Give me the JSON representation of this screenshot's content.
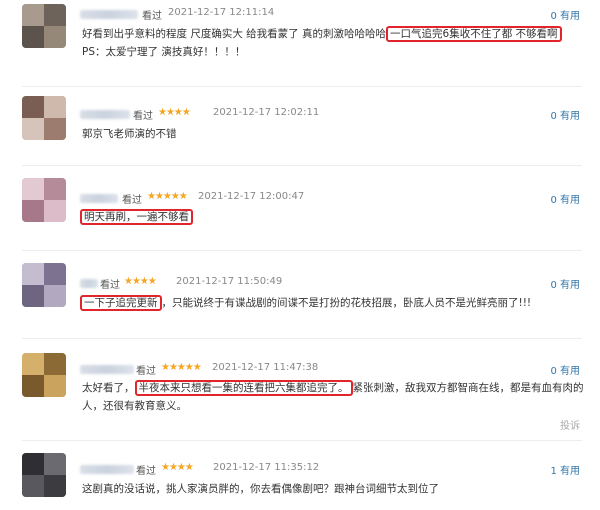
{
  "comments": [
    {
      "status": "看过",
      "stars": "",
      "time": "2021-12-17 12:11:14",
      "useful_count": "0",
      "useful_label": "有用",
      "text_before": "好看到出乎意料的程度 尺度确实大 给我看蒙了 真的刺激哈哈哈哈",
      "text_highlight": "一口气追完6集收不住了都 不够看啊",
      "text_line2": "PS：太爱宁理了 演技真好！！！！"
    },
    {
      "status": "看过",
      "stars": "★★★★",
      "time": "2021-12-17 12:02:11",
      "useful_count": "0",
      "useful_label": "有用",
      "text": "郭京飞老师演的不错"
    },
    {
      "status": "看过",
      "stars": "★★★★★",
      "time": "2021-12-17 12:00:47",
      "useful_count": "0",
      "useful_label": "有用",
      "text_highlight": "明天再刷，一遍不够看"
    },
    {
      "status": "看过",
      "stars": "★★★★",
      "time": "2021-12-17 11:50:49",
      "useful_count": "0",
      "useful_label": "有用",
      "text_highlight": "一下子追完更新",
      "text_after": "，只能说终于有谍战剧的间谍不是打扮的花枝招展，卧底人员不是光鲜亮丽了!!!"
    },
    {
      "status": "看过",
      "stars": "★★★★★",
      "time": "2021-12-17 11:47:38",
      "useful_count": "0",
      "useful_label": "有用",
      "text_before": "太好看了，",
      "text_highlight": "半夜本来只想看一集的连看把六集都追完了。",
      "text_after": "紧张刺激，敌我双方都智商在线，都是有血有肉的",
      "text_line2": "人，还很有教育意义。",
      "report": "投诉"
    },
    {
      "status": "看过",
      "stars": "★★★★",
      "time": "2021-12-17 11:35:12",
      "useful_count": "1",
      "useful_label": "有用",
      "text": "这剧真的没话说，挑人家演员胖的，你去看偶像剧吧？跟神台词细节太到位了"
    }
  ],
  "colors": {
    "accent_link": "#3377aa",
    "highlight_box": "#e0262c",
    "star": "#f5a623"
  }
}
